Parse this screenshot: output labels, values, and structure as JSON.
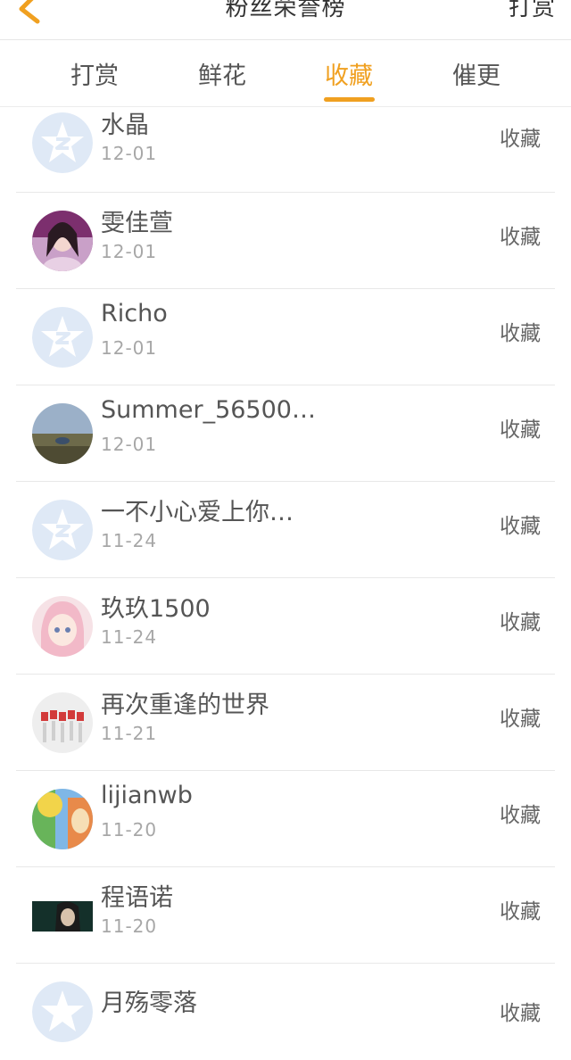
{
  "header": {
    "title": "粉丝荣誉榜",
    "right_label": "打赏"
  },
  "tabs": [
    {
      "label": "打赏",
      "active": false
    },
    {
      "label": "鲜花",
      "active": false
    },
    {
      "label": "收藏",
      "active": true
    },
    {
      "label": "催更",
      "active": false
    }
  ],
  "colors": {
    "accent": "#f0a020",
    "default_avatar": "#dfe9f6"
  },
  "rows": [
    {
      "name": "水晶",
      "date": "12-01",
      "action": "收藏",
      "avatar": "default-star"
    },
    {
      "name": "雯佳萱",
      "date": "12-01",
      "action": "收藏",
      "avatar": "photo-girl"
    },
    {
      "name": "Richo",
      "date": "12-01",
      "action": "收藏",
      "avatar": "default-star"
    },
    {
      "name": "Summer_56500…",
      "date": "12-01",
      "action": "收藏",
      "avatar": "photo-landscape"
    },
    {
      "name": "一不小心爱上你…",
      "date": "11-24",
      "action": "收藏",
      "avatar": "default-star"
    },
    {
      "name": "玖玖1500",
      "date": "11-24",
      "action": "收藏",
      "avatar": "anime-girl"
    },
    {
      "name": "再次重逢的世界",
      "date": "11-21",
      "action": "收藏",
      "avatar": "photo-dancers"
    },
    {
      "name": "lijianwb",
      "date": "11-20",
      "action": "收藏",
      "avatar": "painting"
    },
    {
      "name": "程语诺",
      "date": "11-20",
      "action": "收藏",
      "avatar": "photo-dark"
    },
    {
      "name": "月殇零落",
      "date": "",
      "action": "收藏",
      "avatar": "default-star"
    }
  ]
}
